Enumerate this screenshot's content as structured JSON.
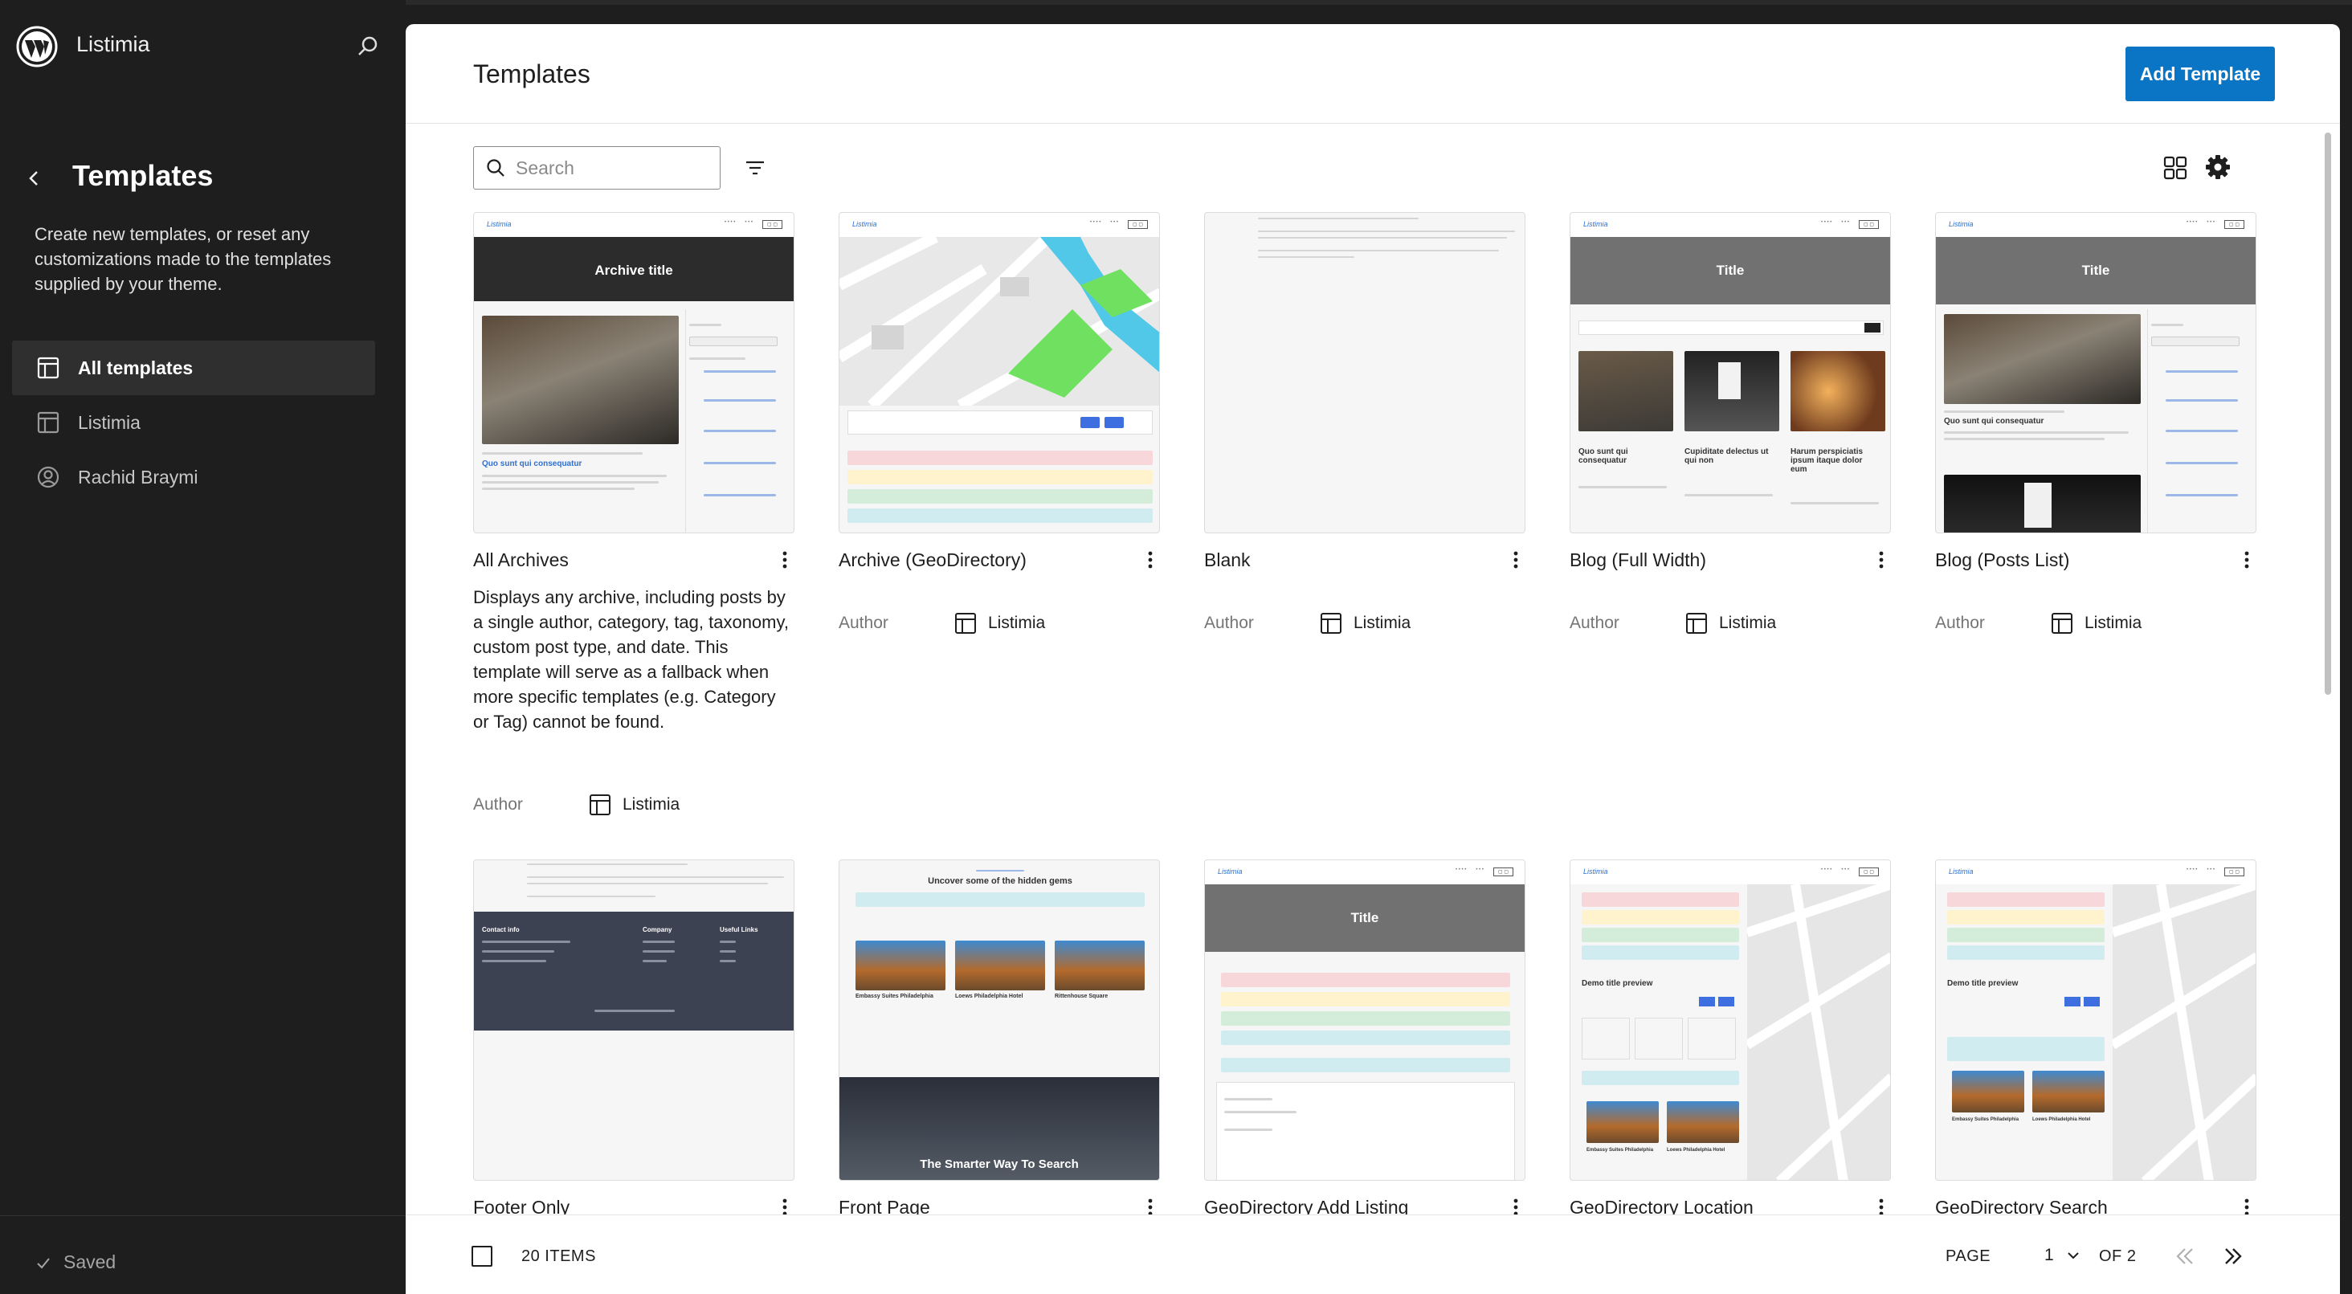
{
  "site": {
    "name": "Listimia"
  },
  "sidebar": {
    "title": "Templates",
    "description": "Create new templates, or reset any customizations made to the templates supplied by your theme.",
    "items": [
      {
        "label": "All templates",
        "icon": "layout-icon",
        "active": true
      },
      {
        "label": "Listimia",
        "icon": "layout-icon",
        "active": false
      },
      {
        "label": "Rachid Braymi",
        "icon": "user-circle-icon",
        "active": false
      }
    ],
    "saved_label": "Saved"
  },
  "header": {
    "title": "Templates",
    "add_button": "Add Template"
  },
  "toolbar": {
    "search_placeholder": "Search"
  },
  "cards": [
    {
      "title": "All Archives",
      "description": "Displays any archive, including posts by a single author, category, tag, taxonomy, custom post type, and date. This template will serve as a fallback when more specific templates (e.g. Category or Tag) cannot be found.",
      "author_label": "Author",
      "theme": "Listimia",
      "thumb": {
        "hero": "Archive title",
        "post_title": "Quo sunt qui consequatur"
      }
    },
    {
      "title": "Archive (GeoDirectory)",
      "author_label": "Author",
      "theme": "Listimia"
    },
    {
      "title": "Blank",
      "author_label": "Author",
      "theme": "Listimia"
    },
    {
      "title": "Blog (Full Width)",
      "author_label": "Author",
      "theme": "Listimia",
      "thumb": {
        "hero": "Title",
        "p1": "Quo sunt qui consequatur",
        "p2": "Cupiditate delectus ut qui non",
        "p3": "Harum perspiciatis ipsum itaque dolor eum"
      }
    },
    {
      "title": "Blog (Posts List)",
      "author_label": "Author",
      "theme": "Listimia",
      "thumb": {
        "hero": "Title",
        "post_title": "Quo sunt qui consequatur"
      }
    },
    {
      "title": "Footer Only",
      "thumb": {
        "col1": "Contact info",
        "col2": "Company",
        "col3": "Useful Links"
      }
    },
    {
      "title": "Front Page",
      "thumb": {
        "heading": "Uncover some of the hidden gems",
        "hero2": "The Smarter Way To Search",
        "l1": "Embassy Suites Philadelphia",
        "l2": "Loews Philadelphia Hotel",
        "l3": "Rittenhouse Square"
      }
    },
    {
      "title": "GeoDirectory Add Listing",
      "thumb": {
        "hero": "Title"
      }
    },
    {
      "title": "GeoDirectory Location",
      "thumb": {
        "demo": "Demo title preview",
        "l1": "Embassy Suites Philadelphia",
        "l2": "Loews Philadelphia Hotel"
      }
    },
    {
      "title": "GeoDirectory Search",
      "thumb": {
        "demo": "Demo title preview",
        "l1": "Embassy Suites Philadelphia",
        "l2": "Loews Philadelphia Hotel"
      }
    }
  ],
  "footer": {
    "items_count": "20 ITEMS",
    "page_label": "PAGE",
    "page_value": "1",
    "of_label": "OF 2"
  },
  "colors": {
    "accent": "#0a75c4",
    "sidebar_bg": "#1e1e1e"
  }
}
